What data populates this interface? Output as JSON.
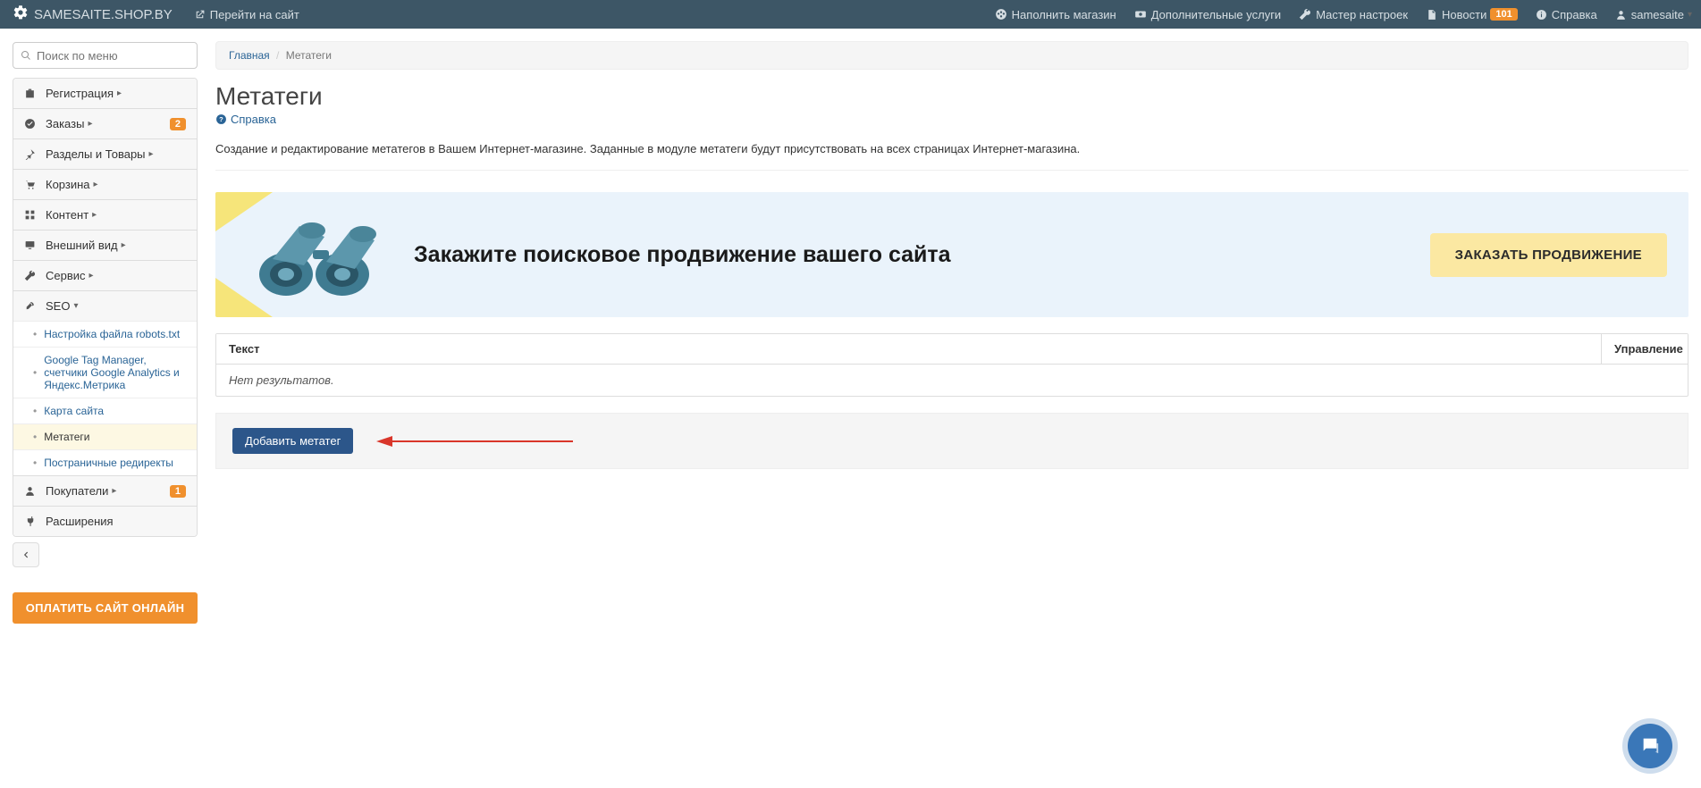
{
  "brand": "SAMESAITE.SHOP.BY",
  "nav": {
    "goto_site": "Перейти на сайт",
    "fill_store": "Наполнить магазин",
    "extra_services": "Дополнительные услуги",
    "settings_wizard": "Мастер настроек",
    "news": "Новости",
    "news_badge": "101",
    "help": "Справка",
    "user": "samesaite"
  },
  "sidebar": {
    "search_placeholder": "Поиск по меню",
    "items": [
      {
        "label": "Регистрация"
      },
      {
        "label": "Заказы",
        "badge": "2"
      },
      {
        "label": "Разделы и Товары"
      },
      {
        "label": "Корзина"
      },
      {
        "label": "Контент"
      },
      {
        "label": "Внешний вид"
      },
      {
        "label": "Сервис"
      },
      {
        "label": "SEO",
        "expanded": true
      },
      {
        "label": "Покупатели",
        "badge": "1"
      },
      {
        "label": "Расширения"
      }
    ],
    "seo_sub": [
      "Настройка файла robots.txt",
      "Google Tag Manager, счетчики Google Analytics и Яндекс.Метрика",
      "Карта сайта",
      "Метатеги",
      "Постраничные редиректы"
    ],
    "pay_button": "ОПЛАТИТЬ САЙТ ОНЛАЙН"
  },
  "breadcrumb": {
    "home": "Главная",
    "current": "Метатеги"
  },
  "page": {
    "title": "Метатеги",
    "help": "Справка",
    "description": "Создание и редактирование метатегов в Вашем Интернет-магазине. Заданные в модуле метатеги будут присутствовать на всех страницах Интернет-магазина."
  },
  "banner": {
    "title": "Закажите поисковое продвижение вашего сайта",
    "button": "ЗАКАЗАТЬ ПРОДВИЖЕНИЕ"
  },
  "table": {
    "col_text": "Текст",
    "col_manage": "Управление",
    "empty": "Нет результатов."
  },
  "actions": {
    "add": "Добавить метатег"
  }
}
